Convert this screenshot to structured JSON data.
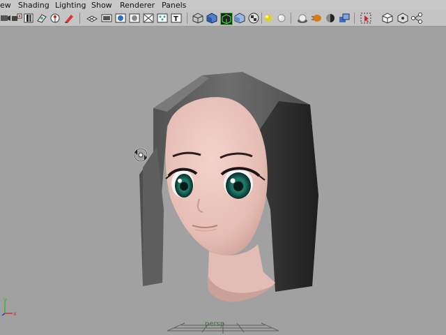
{
  "menubar": {
    "items": [
      "ew",
      "Shading",
      "Lighting",
      "Show",
      "Renderer",
      "Panels"
    ]
  },
  "toolbar": {
    "icons": [
      "select-camera-icon",
      "camera-attributes-icon",
      "bookmark-icon",
      "image-plane-icon",
      "two-d-pan-icon",
      "grease-pencil-icon",
      "grid-icon",
      "film-gate-icon",
      "resolution-gate-icon",
      "gate-mask-icon",
      "field-chart-icon",
      "safe-action-icon",
      "safe-title-icon",
      "wireframe-icon",
      "smooth-shade-icon",
      "wireframe-on-shaded-icon",
      "flat-shade-icon",
      "textured-icon",
      "use-all-lights-icon",
      "shadows-icon",
      "screen-space-ao-icon",
      "motion-blur-icon",
      "multisample-aa-icon",
      "depth-of-field-icon",
      "isolate-select-icon",
      "xray-icon",
      "xray-joints-icon",
      "xray-components-icon"
    ]
  },
  "viewport": {
    "camera_name": "persp",
    "colors": {
      "background": "#a1a1a1",
      "skin": "#e9c3bb",
      "hair": "#5a5a5a",
      "iris": "#1f7e6f",
      "axis_x": "#c83232",
      "axis_y": "#32b432",
      "axis_z": "#3232c8"
    }
  }
}
